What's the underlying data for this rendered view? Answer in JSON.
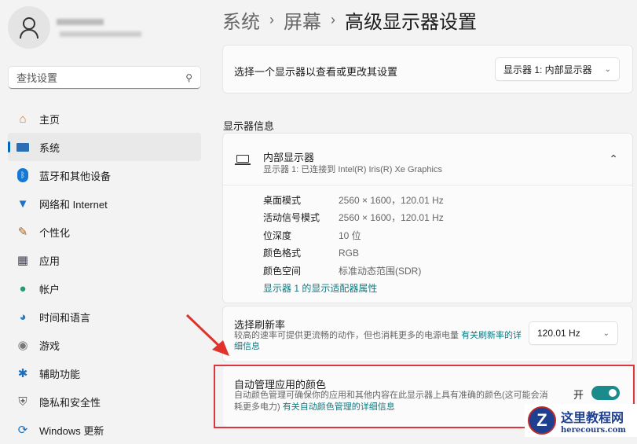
{
  "sidebar": {
    "search_placeholder": "查找设置",
    "items": [
      {
        "label": "主页",
        "icon": "home-icon"
      },
      {
        "label": "系统",
        "icon": "system-icon",
        "selected": true
      },
      {
        "label": "蓝牙和其他设备",
        "icon": "bluetooth-icon"
      },
      {
        "label": "网络和 Internet",
        "icon": "wifi-icon"
      },
      {
        "label": "个性化",
        "icon": "brush-icon"
      },
      {
        "label": "应用",
        "icon": "apps-icon"
      },
      {
        "label": "帐户",
        "icon": "account-icon"
      },
      {
        "label": "时间和语言",
        "icon": "globe-icon"
      },
      {
        "label": "游戏",
        "icon": "gamepad-icon"
      },
      {
        "label": "辅助功能",
        "icon": "accessibility-icon"
      },
      {
        "label": "隐私和安全性",
        "icon": "shield-icon"
      },
      {
        "label": "Windows 更新",
        "icon": "update-icon"
      }
    ]
  },
  "breadcrumb": [
    "系统",
    "屏幕",
    "高级显示器设置"
  ],
  "display_select": {
    "label": "选择一个显示器以查看或更改其设置",
    "value": "显示器 1: 内部显示器"
  },
  "section_title": "显示器信息",
  "display_info": {
    "name": "内部显示器",
    "subtitle": "显示器 1: 已连接到 Intel(R) Iris(R) Xe Graphics",
    "rows": [
      {
        "k": "桌面模式",
        "v": "2560 × 1600，120.01 Hz"
      },
      {
        "k": "活动信号模式",
        "v": "2560 × 1600，120.01 Hz"
      },
      {
        "k": "位深度",
        "v": "10 位"
      },
      {
        "k": "颜色格式",
        "v": "RGB"
      },
      {
        "k": "颜色空间",
        "v": "标准动态范围(SDR)"
      }
    ],
    "adapter_link": "显示器 1 的显示适配器属性"
  },
  "refresh": {
    "title": "选择刷新率",
    "desc": "较高的速率可提供更流畅的动作，但也消耗更多的电源电量",
    "link": "有关刷新率的详细信息",
    "value": "120.01 Hz"
  },
  "auto_color": {
    "title": "自动管理应用的颜色",
    "desc": "自动颜色管理可确保你的应用和其他内容在此显示器上具有准确的颜色(这可能会消耗更多电力)",
    "link": "有关自动颜色管理的详细信息",
    "toggle_label": "开",
    "on": true
  },
  "watermark": {
    "title": "这里教程网",
    "url": "herecours.com"
  },
  "colors": {
    "accent": "#0067c0",
    "toggle": "#1a8a8a",
    "link": "#0e7a80",
    "highlight": "#d9363e"
  }
}
